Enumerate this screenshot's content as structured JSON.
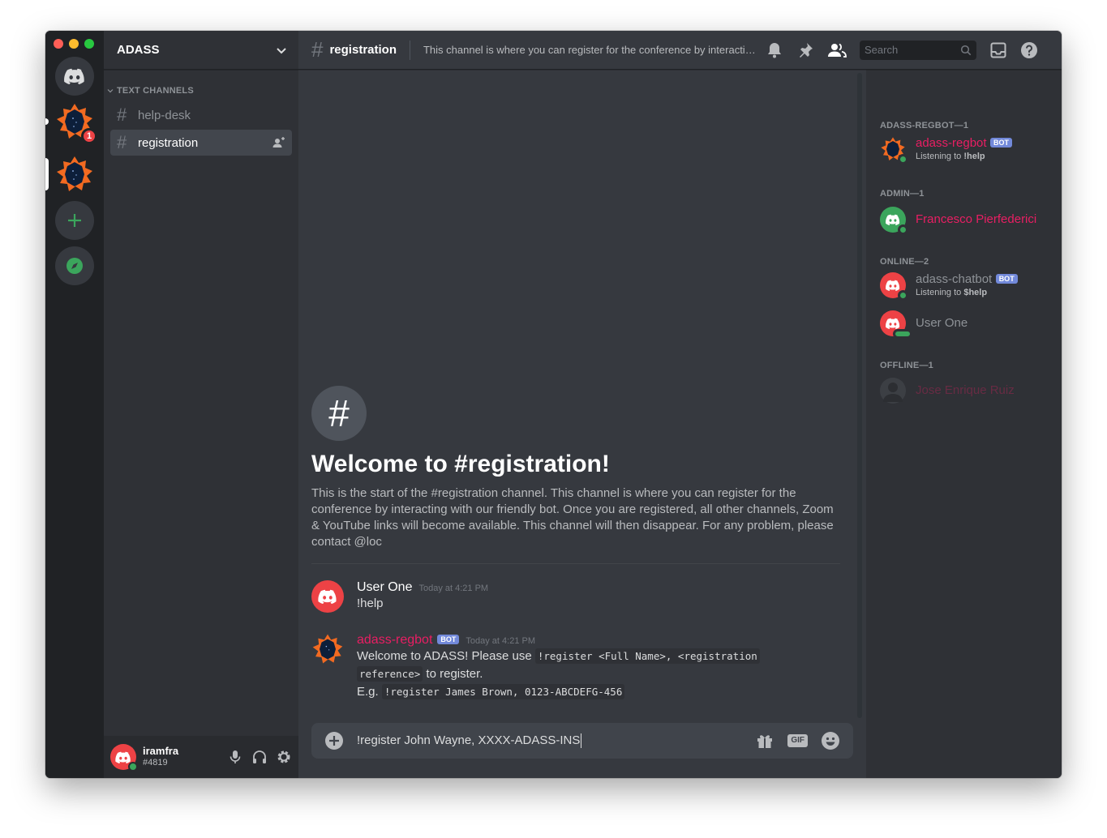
{
  "server": {
    "name": "ADASS",
    "unread_badge": "1"
  },
  "categories": {
    "text_channels": "TEXT CHANNELS"
  },
  "channels": [
    {
      "name": "help-desk",
      "active": false
    },
    {
      "name": "registration",
      "active": true
    }
  ],
  "user": {
    "name": "iramfra",
    "tag": "#4819"
  },
  "header": {
    "channel": "registration",
    "topic": "This channel is where you can register for the conference by interacting with our friendly bot.",
    "search_placeholder": "Search"
  },
  "welcome": {
    "icon": "#",
    "title": "Welcome to #registration!",
    "text": "This is the start of the #registration channel. This channel is where you can register for the conference by interacting with our friendly bot. Once you are registered, all other channels, Zoom & YouTube links will become available. This channel will then disappear. For any problem, please contact @loc"
  },
  "messages": [
    {
      "author": "User One",
      "timestamp": "Today at 4:21 PM",
      "text": "!help"
    },
    {
      "author": "adass-regbot",
      "bot_tag": "BOT",
      "timestamp": "Today at 4:21 PM",
      "line1_pre": "Welcome to ADASS! Please use ",
      "line1_code": "!register <Full Name>, <registration",
      "line2_code": "reference>",
      "line2_post": " to register.",
      "line3_pre": "E.g. ",
      "line3_code": "!register James Brown, 0123-ABCDEFG-456"
    }
  ],
  "composer": {
    "value": "!register John Wayne, XXXX-ADASS-INS",
    "gif_label": "GIF"
  },
  "members": {
    "groups": [
      {
        "label": "ADASS-REGBOT—1"
      },
      {
        "label": "ADMIN—1"
      },
      {
        "label": "ONLINE—2"
      },
      {
        "label": "OFFLINE—1"
      }
    ],
    "list": [
      {
        "name": "adass-regbot",
        "bot_tag": "BOT",
        "activity_prefix": "Listening to ",
        "activity": "!help"
      },
      {
        "name": "Francesco Pierfederici"
      },
      {
        "name": "adass-chatbot",
        "bot_tag": "BOT",
        "activity_prefix": "Listening to ",
        "activity": "$help"
      },
      {
        "name": "User One"
      },
      {
        "name": "Jose Enrique Ruiz"
      }
    ]
  },
  "colors": {
    "blurple": "#7289da",
    "danger": "#ed4245",
    "online": "#3ba55c",
    "role_pink": "#e91e63",
    "server_orange": "#f26a21"
  }
}
